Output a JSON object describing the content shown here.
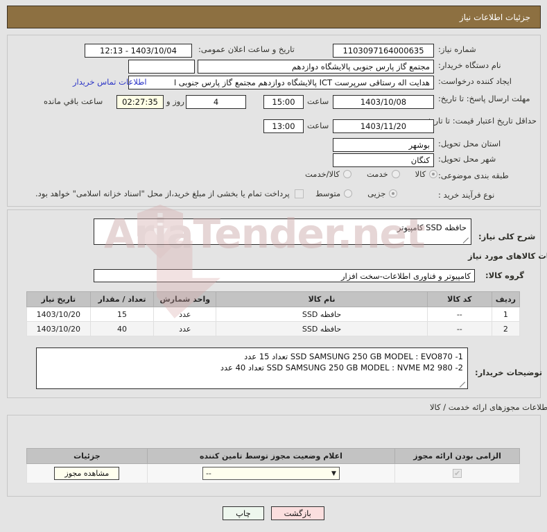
{
  "window": {
    "title": "جزئیات اطلاعات نیاز"
  },
  "form": {
    "need_number_label": "شماره نیاز:",
    "need_number_value": "1103097164000635",
    "announce_label": "تاریخ و ساعت اعلان عمومی:",
    "announce_value": "1403/10/04 - 12:13",
    "buyer_org_label": "نام دستگاه خریدار:",
    "buyer_org_value": "مجتمع گاز پارس جنوبی  پالایشگاه دوازدهم",
    "buyer_org_value2": "",
    "creator_label": "ایجاد کننده درخواست:",
    "creator_value": "هدایت اله رستاقی سرپرست ICT پالایشگاه دوازدهم  مجتمع گاز پارس جنوبی  ا",
    "contact_link": "اطلاعات تماس خریدار",
    "deadline_label": "مهلت ارسال پاسخ: تا تاریخ:",
    "deadline_date": "1403/10/08",
    "hour_label": "ساعت",
    "deadline_time": "15:00",
    "days_value": "4",
    "days_label": "روز و",
    "countdown_value": "02:27:35",
    "countdown_label": "ساعت باقي مانده",
    "price_validity_label": "حداقل تاریخ اعتبار قیمت: تا تاریخ:",
    "price_validity_date": "1403/11/20",
    "price_validity_time": "13:00",
    "province_label": "استان محل تحویل:",
    "province_value": "بوشهر",
    "city_label": "شهر محل تحویل:",
    "city_value": "کنگان",
    "category_label": "طبقه بندی موضوعی:",
    "category_options": [
      {
        "label": "کالا",
        "selected": true
      },
      {
        "label": "خدمت",
        "selected": false
      },
      {
        "label": "کالا/خدمت",
        "selected": false
      }
    ],
    "purchase_type_label": "نوع فرآیند خرید :",
    "purchase_type_options": [
      {
        "label": "جزیی",
        "selected": true
      },
      {
        "label": "متوسط",
        "selected": false
      }
    ],
    "treasury_checkbox_label": "پرداخت تمام یا بخشی از مبلغ خرید،از محل \"اسناد خزانه اسلامی\" خواهد بود.",
    "treasury_checked": false
  },
  "summary": {
    "label": "شرح کلی نیاز:",
    "value": "حافظه SSD  کامپیوتر"
  },
  "goods_section": {
    "heading": "اطلاعات کالاهای مورد نیاز",
    "group_label": "گروه کالا:",
    "group_value": "کامپیوتر و فناوری اطلاعات-سخت افزار",
    "columns": [
      "ردیف",
      "کد کالا",
      "نام کالا",
      "واحد شمارش",
      "تعداد / مقدار",
      "تاریخ نیاز"
    ],
    "rows": [
      {
        "row": "1",
        "code": "--",
        "name": "حافظه SSD",
        "unit": "عدد",
        "qty": "15",
        "date": "1403/10/20"
      },
      {
        "row": "2",
        "code": "--",
        "name": "حافظه SSD",
        "unit": "عدد",
        "qty": "40",
        "date": "1403/10/20"
      }
    ],
    "buyer_notes_label": "توضیحات خریدار:",
    "buyer_notes_line1": "1- SSD SAMSUNG 250 GB MODEL : EVO870  تعداد 15 عدد",
    "buyer_notes_line2": "2- SSD SAMSUNG 250 GB MODEL : NVME M2 980 تعداد 40 عدد"
  },
  "permit_section": {
    "heading": "اطلاعات مجوزهای ارائه خدمت / کالا",
    "columns": [
      "الزامی بودن ارائه مجوز",
      "اعلام وضعیت مجوز توسط تامین کننده",
      "جزئیات"
    ],
    "row": {
      "required_checked": true,
      "status_value": "--",
      "details_button": "مشاهده مجوز"
    }
  },
  "footer": {
    "print_button": "چاپ",
    "back_button": "بازگشت"
  },
  "watermark": {
    "text": "AriaTender.net"
  },
  "colors": {
    "titlebar": "#8d7041",
    "page_bg": "#e4e4e4",
    "link": "#2c35c6",
    "table_header": "#c3c3c3",
    "print_btn": "#eef7ee",
    "back_btn": "#fbdede",
    "cream_field": "#ffffe6"
  }
}
